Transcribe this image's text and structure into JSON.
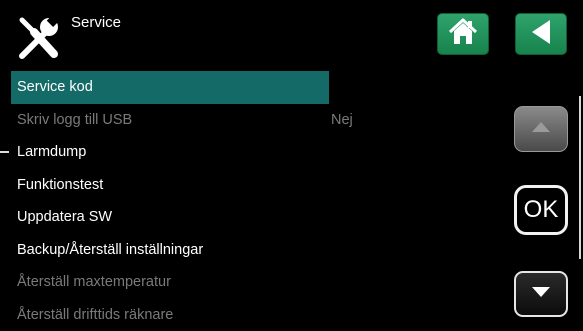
{
  "header": {
    "title": "Service",
    "icon": "tools-icon",
    "home_icon": "home-icon",
    "back_icon": "back-arrow-icon"
  },
  "menu": {
    "items": [
      {
        "label": "Service kod",
        "value": "",
        "state": "selected"
      },
      {
        "label": "Skriv logg till USB",
        "value": "Nej",
        "state": "disabled"
      },
      {
        "label": "Larmdump",
        "value": "",
        "state": "enabled"
      },
      {
        "label": "Funktionstest",
        "value": "",
        "state": "enabled"
      },
      {
        "label": "Uppdatera SW",
        "value": "",
        "state": "enabled"
      },
      {
        "label": "Backup/Återställ inställningar",
        "value": "",
        "state": "enabled"
      },
      {
        "label": "Återställ maxtemperatur",
        "value": "",
        "state": "disabled"
      },
      {
        "label": "Återställ drifttids räknare",
        "value": "",
        "state": "disabled"
      }
    ]
  },
  "controls": {
    "ok_label": "OK",
    "scroll_up_icon": "arrow-up-icon",
    "scroll_down_icon": "arrow-down-icon"
  },
  "colors": {
    "accent_green": "#2fa36c",
    "selection": "#146a66",
    "disabled_text": "#7a7a7a"
  }
}
